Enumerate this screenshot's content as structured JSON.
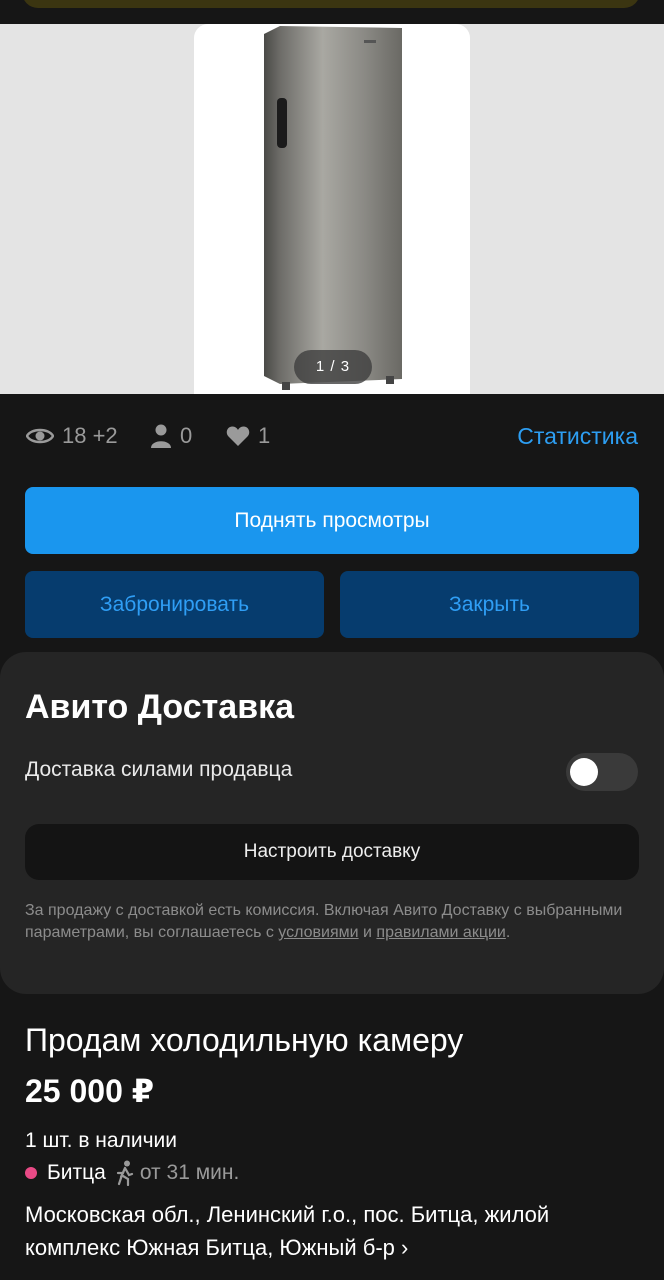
{
  "gallery": {
    "counter": "1 / 3"
  },
  "stats": {
    "views": "18 +2",
    "contacts": "0",
    "favorites": "1",
    "link": "Статистика"
  },
  "actions": {
    "boost": "Поднять просмотры",
    "reserve": "Забронировать",
    "close": "Закрыть"
  },
  "delivery": {
    "title": "Авито Доставка",
    "seller_delivery_label": "Доставка силами продавца",
    "seller_delivery_enabled": false,
    "setup_button": "Настроить доставку",
    "note_prefix": "За продажу с доставкой есть комиссия. Включая Авито Доставку с выбранными параметрами, вы соглашаетесь с ",
    "terms_link": "условиями",
    "note_and": " и ",
    "rules_link": "правилами акции",
    "note_suffix": "."
  },
  "ad": {
    "title": "Продам холодильную камеру",
    "price": "25 000 ₽",
    "stock": "1 шт. в наличии",
    "metro_station": "Битца",
    "metro_time": "от 31 мин.",
    "metro_color": "#e94a86",
    "address": "Московская обл., Ленинский г.о., пос. Битца, жилой комплекс Южная Битца, Южный б-р",
    "address_chevron": "›"
  },
  "colors": {
    "accent_blue": "#1a96ee",
    "secondary_button": "#063c6e",
    "background": "#161616"
  }
}
